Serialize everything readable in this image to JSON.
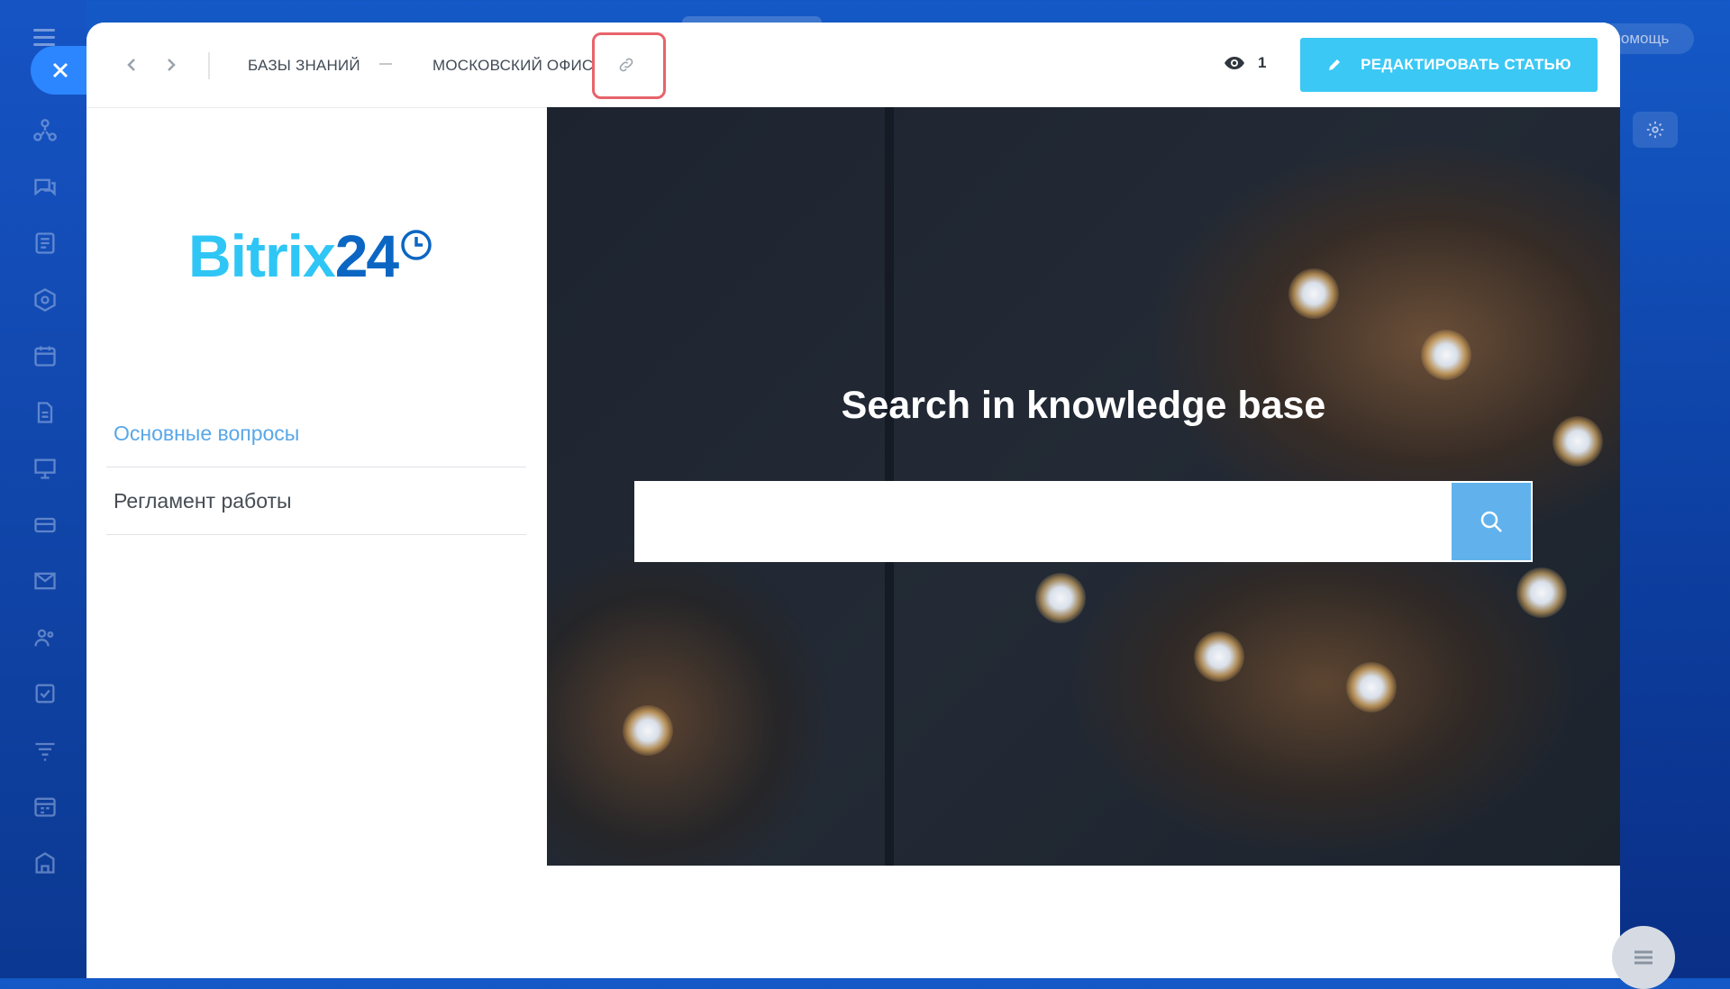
{
  "background": {
    "help_label": "помощь",
    "sidebar_icons": [
      "network-icon",
      "chat-icon",
      "feed-icon",
      "hexagon-icon",
      "calendar-icon",
      "document-icon",
      "presentation-icon",
      "card-icon",
      "mail-icon",
      "users-icon",
      "task-icon",
      "filter-icon",
      "schedule-icon",
      "building-icon"
    ]
  },
  "header": {
    "breadcrumbs": [
      "БАЗЫ ЗНАНИЙ",
      "МОСКОВСКИЙ ОФИС"
    ],
    "views_count": "1",
    "edit_button": "РЕДАКТИРОВАТЬ СТАТЬЮ"
  },
  "logo": {
    "part1": "Bitrix",
    "part2": "24"
  },
  "menu": {
    "items": [
      {
        "label": "Основные вопросы",
        "active": true
      },
      {
        "label": "Регламент работы",
        "active": false
      }
    ]
  },
  "hero": {
    "title": "Search in knowledge base",
    "search_value": ""
  },
  "colors": {
    "accent": "#3bc8f5",
    "active_menu": "#59a7e8",
    "highlight_box": "#e8636a",
    "search_button": "#61b2ec"
  }
}
